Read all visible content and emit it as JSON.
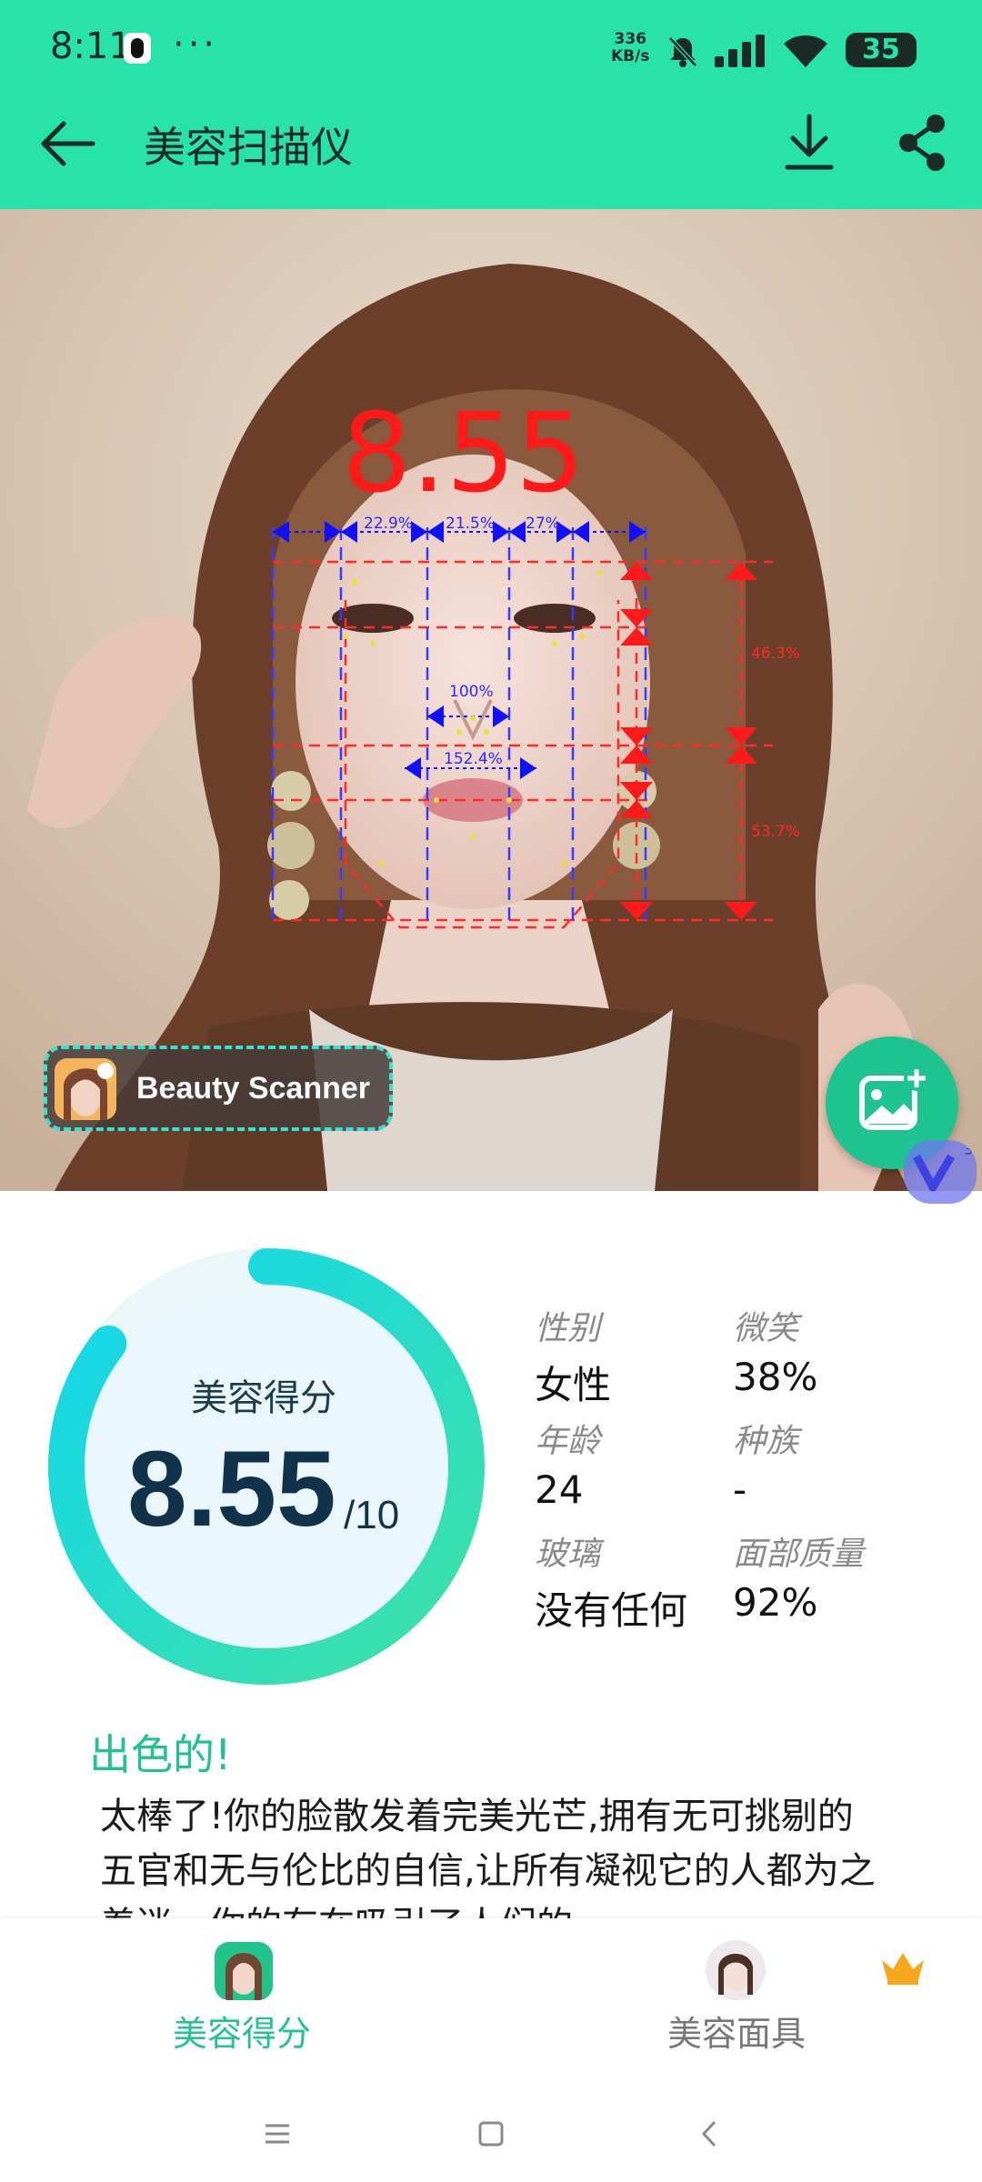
{
  "status_bar": {
    "time": "8:11",
    "dots": "···",
    "net_speed_value": "336",
    "net_speed_unit": "KB/s",
    "battery": "35"
  },
  "app_bar": {
    "title": "美容扫描仪"
  },
  "photo": {
    "score_overlay": "8.55",
    "badge_text": "Beauty Scanner",
    "measure_labels": [
      "22.9%",
      "21.5%",
      "27%",
      "100%",
      "152.4%",
      "46.3%",
      "53.7%"
    ]
  },
  "score_card": {
    "label": "美容得分",
    "score": "8.55",
    "max": "/10",
    "progress": 0.855
  },
  "stats": [
    {
      "label": "性别",
      "value": "女性"
    },
    {
      "label": "微笑",
      "value": "38%"
    },
    {
      "label": "年龄",
      "value": "24"
    },
    {
      "label": "种族",
      "value": "-"
    },
    {
      "label": "玻璃",
      "value": "没有任何"
    },
    {
      "label": "面部质量",
      "value": "92%"
    }
  ],
  "result": {
    "verdict": "出色的!",
    "description": "太棒了!你的脸散发着完美光芒,拥有无可挑剔的五官和无与伦比的自信,让所有凝视它的人都为之着迷。你的存在吸引了人们的"
  },
  "bottom_nav": {
    "items": [
      {
        "label": "美容得分",
        "active": true
      },
      {
        "label": "美容面具",
        "active": false
      }
    ]
  },
  "colors": {
    "brand": "#27e3a8",
    "accent_green": "#20c489",
    "score_red": "#ff1a1a"
  }
}
